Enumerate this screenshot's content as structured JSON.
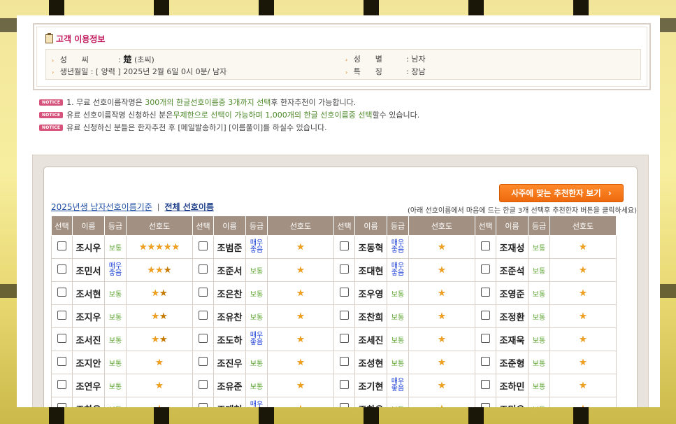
{
  "customer_info": {
    "title": "고객 이용정보",
    "surname_label": "성      씨",
    "surname_hanja": "楚",
    "surname_reading": "(초씨)",
    "birth_label": "생년월일",
    "birth_value": ": [ 양력 ] 2025년 2월 6일 0시 0분/ 남자",
    "gender_label": "성      별",
    "gender_value": ": 남자",
    "feature_label": "특      징",
    "feature_value": ": 장남"
  },
  "notices": [
    {
      "badge": "NOTICE",
      "parts": [
        "1. 무료 선호이름작명은 ",
        "300개의 한글선호이름중 3개까지 선택",
        "후 한자추천이 가능합니다."
      ]
    },
    {
      "badge": "NOTICE",
      "parts": [
        "유료 선호이름작명 신청하신 분은",
        "무제한으로 선택이 가능하며 1,000개의 한글 선호이름중 선택",
        "할수 있습니다."
      ]
    },
    {
      "badge": "NOTICE",
      "parts": [
        "유료 신청하신 분들은 한자추천 후 [메일발송하기] [이름풀이]를 하실수 있습니다.",
        "",
        ""
      ]
    }
  ],
  "tabs": {
    "tab1": "2025년생 남자선호이름기준",
    "separator": "|",
    "tab2": "전체 선호이름"
  },
  "recommend_button": "사주에 맞는 추천한자 보기",
  "help_text": "(아래 선호이름에서 마음에 드는 한글 3개 선택후 추천한자 버튼을 클릭하세요)",
  "table_headers": [
    "선택",
    "이름",
    "등급",
    "선호도"
  ],
  "grade_labels": {
    "normal": "보통",
    "very_good": "매우\n좋음"
  },
  "rows": [
    [
      {
        "name": "조시우",
        "grade": "normal",
        "stars": 5
      },
      {
        "name": "조범준",
        "grade": "very_good",
        "stars": 1
      },
      {
        "name": "조동혁",
        "grade": "very_good",
        "stars": 1
      },
      {
        "name": "조재성",
        "grade": "normal",
        "stars": 1
      }
    ],
    [
      {
        "name": "조민서",
        "grade": "very_good",
        "stars": 2.5
      },
      {
        "name": "조준서",
        "grade": "normal",
        "stars": 1
      },
      {
        "name": "조대현",
        "grade": "very_good",
        "stars": 1
      },
      {
        "name": "조준석",
        "grade": "normal",
        "stars": 1
      }
    ],
    [
      {
        "name": "조서현",
        "grade": "normal",
        "stars": 1.5
      },
      {
        "name": "조은찬",
        "grade": "normal",
        "stars": 1
      },
      {
        "name": "조우영",
        "grade": "normal",
        "stars": 1
      },
      {
        "name": "조영준",
        "grade": "normal",
        "stars": 1
      }
    ],
    [
      {
        "name": "조지우",
        "grade": "normal",
        "stars": 1.5
      },
      {
        "name": "조유찬",
        "grade": "normal",
        "stars": 1
      },
      {
        "name": "조찬희",
        "grade": "normal",
        "stars": 1
      },
      {
        "name": "조정환",
        "grade": "normal",
        "stars": 1
      }
    ],
    [
      {
        "name": "조서진",
        "grade": "normal",
        "stars": 1.5
      },
      {
        "name": "조도하",
        "grade": "very_good",
        "stars": 1
      },
      {
        "name": "조세진",
        "grade": "normal",
        "stars": 1
      },
      {
        "name": "조재욱",
        "grade": "normal",
        "stars": 1
      }
    ],
    [
      {
        "name": "조지안",
        "grade": "normal",
        "stars": 1
      },
      {
        "name": "조진우",
        "grade": "normal",
        "stars": 1
      },
      {
        "name": "조성현",
        "grade": "normal",
        "stars": 1
      },
      {
        "name": "조준형",
        "grade": "normal",
        "stars": 1
      }
    ],
    [
      {
        "name": "조연우",
        "grade": "normal",
        "stars": 1
      },
      {
        "name": "조유준",
        "grade": "normal",
        "stars": 1
      },
      {
        "name": "조기현",
        "grade": "very_good",
        "stars": 1
      },
      {
        "name": "조하민",
        "grade": "normal",
        "stars": 1
      }
    ],
    [
      {
        "name": "조하은",
        "grade": "normal",
        "stars": 1
      },
      {
        "name": "조태현",
        "grade": "very_good",
        "stars": 1
      },
      {
        "name": "조찬우",
        "grade": "normal",
        "stars": 1
      },
      {
        "name": "조민우",
        "grade": "normal",
        "stars": 1
      }
    ]
  ],
  "colors": {
    "accent": "#ee6a0e",
    "header_bg": "#a29182",
    "notice_badge": "#d6547b",
    "highlight_green": "#4f8a2b"
  }
}
